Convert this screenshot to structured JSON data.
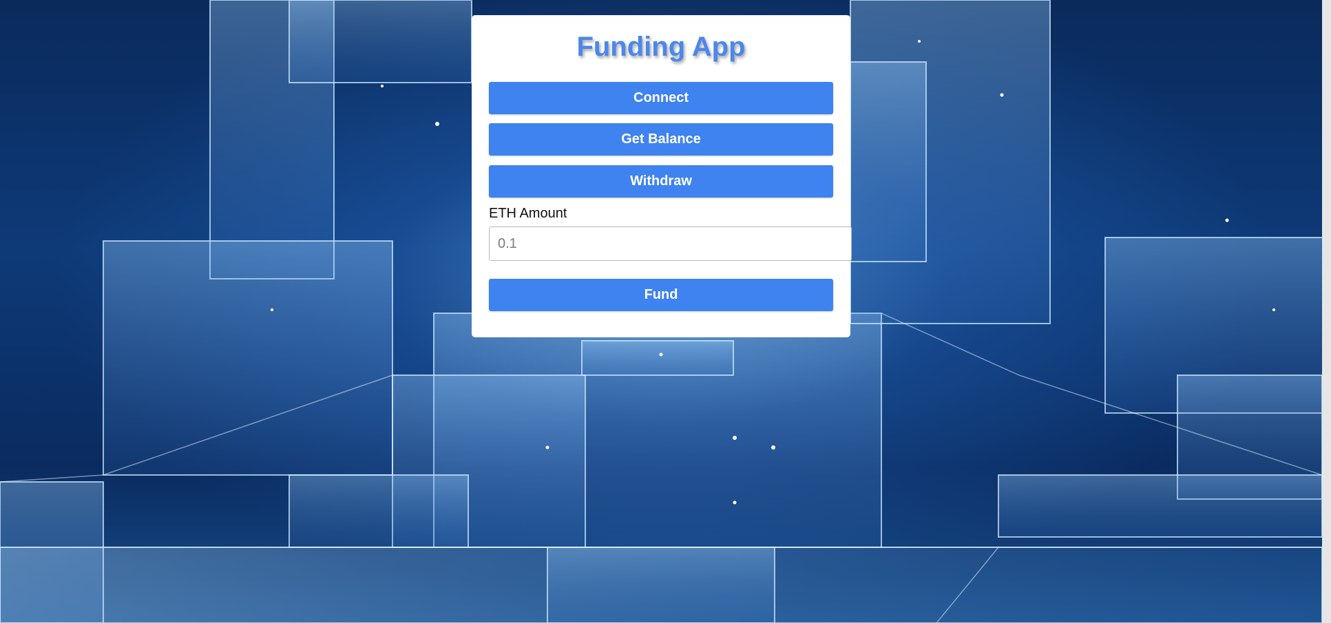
{
  "app": {
    "title": "Funding App"
  },
  "buttons": {
    "connect": "Connect",
    "get_balance": "Get Balance",
    "withdraw": "Withdraw",
    "fund": "Fund"
  },
  "amount": {
    "label": "ETH Amount",
    "placeholder": "0.1",
    "value": ""
  },
  "colors": {
    "accent": "#3f83f0",
    "title": "#4b87ec",
    "card_background": "#ffffff"
  }
}
